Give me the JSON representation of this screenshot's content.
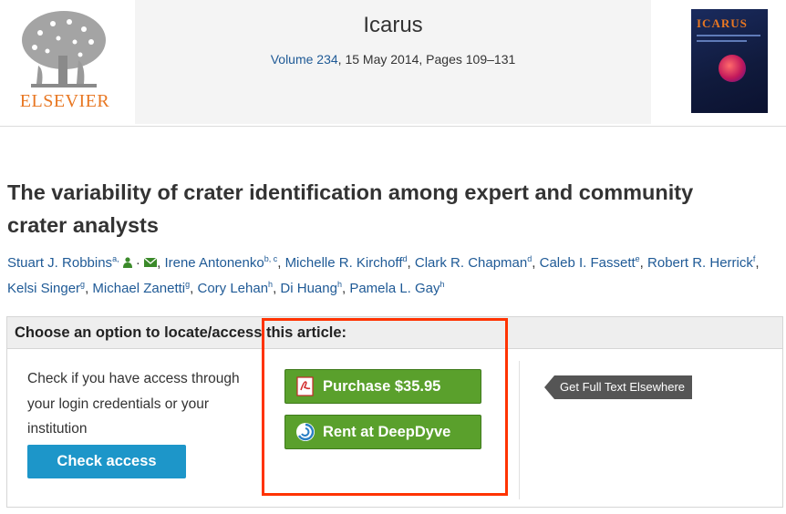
{
  "header": {
    "publisher": "ELSEVIER",
    "journal": "Icarus",
    "volume_link": "Volume 234",
    "issue_info": ", 15 May 2014, Pages 109–131",
    "cover_title": "ICARUS"
  },
  "article": {
    "title": "The variability of crater identification among expert and community crater analysts",
    "authors": [
      {
        "name": "Stuart J. Robbins",
        "sup": "a,",
        "contact_icons": [
          "person-icon",
          "mail-icon"
        ]
      },
      {
        "name": "Irene Antonenko",
        "sup": "b, c"
      },
      {
        "name": "Michelle R. Kirchoff",
        "sup": "d"
      },
      {
        "name": "Clark R. Chapman",
        "sup": "d"
      },
      {
        "name": "Caleb I. Fassett",
        "sup": "e"
      },
      {
        "name": "Robert R. Herrick",
        "sup": "f"
      },
      {
        "name": "Kelsi Singer",
        "sup": "g"
      },
      {
        "name": "Michael Zanetti",
        "sup": "g"
      },
      {
        "name": "Cory Lehan",
        "sup": "h"
      },
      {
        "name": "Di Huang",
        "sup": "h"
      },
      {
        "name": "Pamela L. Gay",
        "sup": "h"
      }
    ]
  },
  "access": {
    "heading": "Choose an option to locate/access this article:",
    "check_text": "Check if you have access through your login credentials or your institution",
    "check_button": "Check access",
    "purchase_button": "Purchase $35.95",
    "rent_button": "Rent at DeepDyve",
    "fulltext_button": "Get Full Text Elsewhere"
  },
  "colors": {
    "link": "#1f5a96",
    "elsevier_orange": "#e87722",
    "check_button_bg": "#1d96c9",
    "buy_button_bg": "#5aa02c",
    "highlight": "#ff3300"
  },
  "icons": {
    "purchase": "pdf-icon",
    "rent": "deepdyve-icon",
    "logo": "elsevier-tree-logo"
  }
}
